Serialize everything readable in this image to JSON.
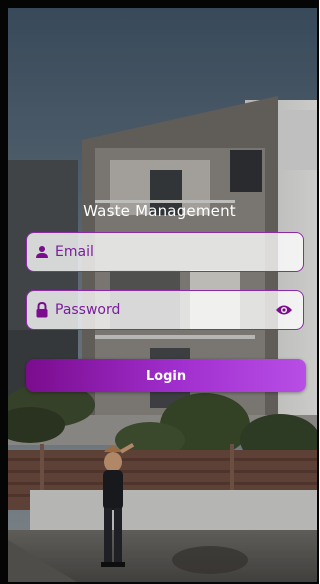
{
  "app": {
    "title": "Waste Management"
  },
  "form": {
    "email": {
      "placeholder": "Email",
      "value": "",
      "icon": "person-icon"
    },
    "password": {
      "placeholder": "Password",
      "value": "",
      "icon": "lock-icon",
      "toggle_icon": "eye-icon"
    },
    "login_label": "Login"
  },
  "colors": {
    "accent": "#8d2aa8",
    "button_start": "#7a0c8d",
    "button_end": "#b84ee6",
    "field_text": "#7a1f9c"
  }
}
